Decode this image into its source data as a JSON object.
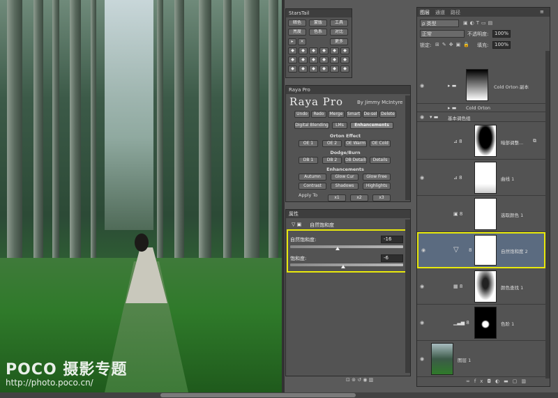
{
  "watermark": {
    "brand": "POCO 摄影专题",
    "url": "http://photo.poco.cn/"
  },
  "starstail": {
    "title": "StarsTail",
    "row1": [
      "暗色",
      "蒙版",
      "工具"
    ],
    "row2": [
      "亮度",
      "色系",
      "对比"
    ],
    "more": "更多"
  },
  "raya": {
    "panel_title": "Raya Pro",
    "logo": "Raya Pro",
    "by": "By Jimmy McIntyre",
    "toolbar": [
      "Undo",
      "Redo",
      "Merge",
      "Smart",
      "De-sel",
      "Delete"
    ],
    "tabs": [
      "Digital Blending",
      "LMs",
      "Enhancements"
    ],
    "orton_title": "Orton Effect",
    "orton": [
      "OE 1",
      "OE 2",
      "OE Warm",
      "OE Cold"
    ],
    "dodge_title": "Dodge/Burn",
    "dodge": [
      "DB 1",
      "DB 2",
      "DB Details",
      "Details"
    ],
    "enh_title": "Enhancements",
    "enh_row1": [
      "Autumn",
      "Glow Cur",
      "Glow Free"
    ],
    "enh_row2": [
      "Contrast",
      "Shadows",
      "Highlights"
    ],
    "apply": "Apply To",
    "apply_btns": [
      "x1",
      "x2",
      "x3"
    ]
  },
  "properties": {
    "title": "属性",
    "adjustment": "自然饱和度",
    "vibrance_label": "自然饱和度:",
    "vibrance_value": "-16",
    "vibrance": -16,
    "saturation_label": "饱和度:",
    "saturation_value": "-6",
    "saturation": -6
  },
  "layers": {
    "tabs": [
      "图层",
      "通道",
      "路径"
    ],
    "filter": "ρ 类型",
    "blend_mode": "正常",
    "opacity_label": "不透明度:",
    "opacity": "100%",
    "lock_label": "锁定:",
    "fill_label": "填充:",
    "fill": "100%",
    "items": [
      {
        "name": "Cold Orton 副本"
      },
      {
        "name": "Cold Orton"
      },
      {
        "name": "基本调色组"
      },
      {
        "name": "暗部调整..."
      },
      {
        "name": "曲线 1"
      },
      {
        "name": "选取颜色 1"
      },
      {
        "name": "自然饱和度 2"
      },
      {
        "name": "颜色查找 1"
      },
      {
        "name": "色阶 1"
      },
      {
        "name": "图层 1"
      }
    ],
    "footer_icons": [
      "link-icon",
      "fx-icon",
      "mask-icon",
      "adjustment-icon",
      "folder-icon",
      "new-layer-icon",
      "trash-icon"
    ]
  },
  "colors": {
    "highlight": "#e9e90c",
    "selected_layer": "#5b6b80",
    "panel_bg": "#535353"
  }
}
